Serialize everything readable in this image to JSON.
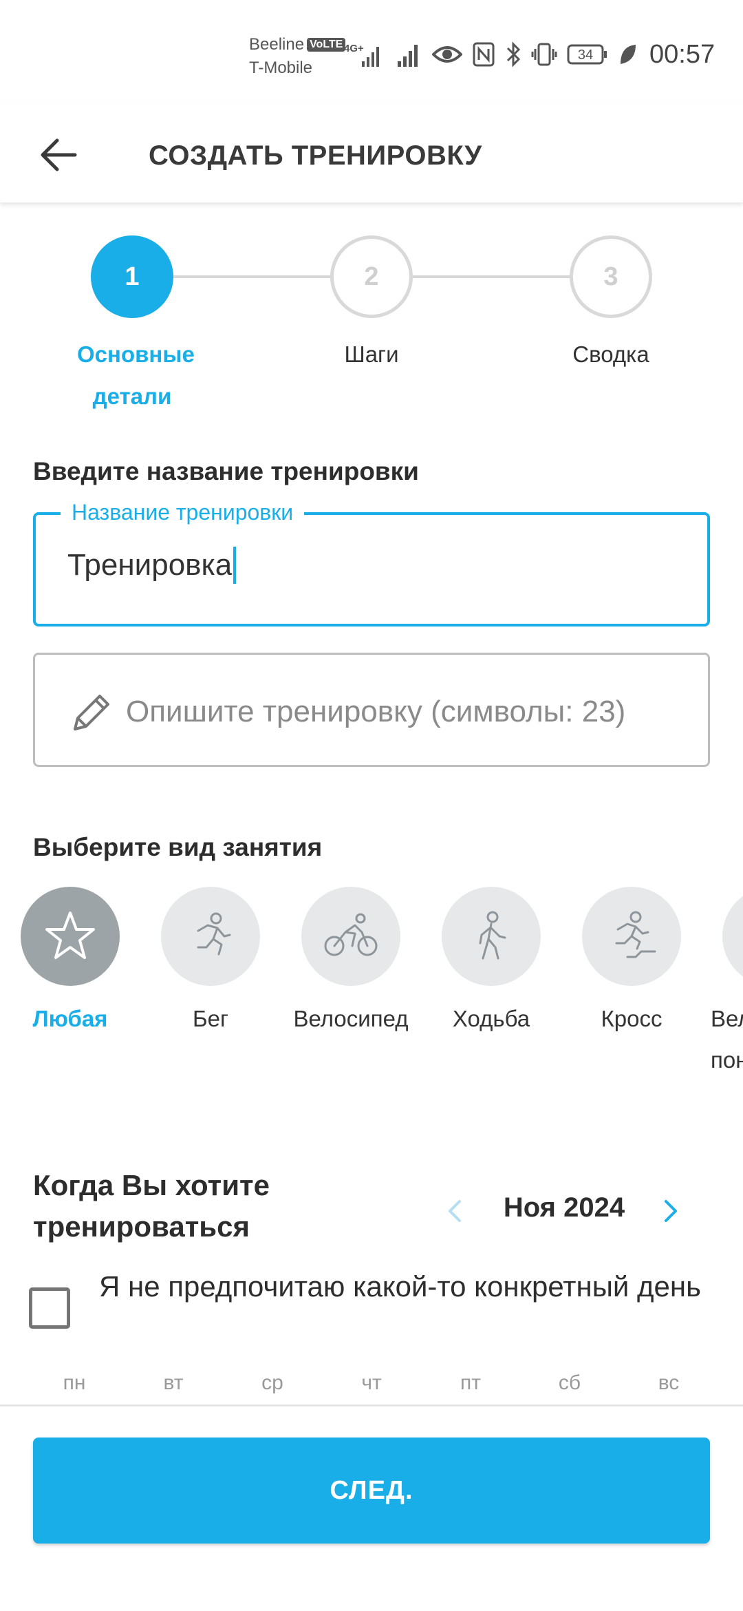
{
  "status_bar": {
    "carrier_1": "Beeline",
    "volte": "VoLTE",
    "carrier_2": "T-Mobile",
    "network": "4G+",
    "battery": "34",
    "time": "00:57"
  },
  "app_bar": {
    "back_icon": "arrow-left-icon",
    "title": "СОЗДАТЬ ТРЕНИРОВКУ"
  },
  "stepper": [
    {
      "number": "1",
      "label": "Основные детали",
      "active": true
    },
    {
      "number": "2",
      "label": "Шаги",
      "active": false
    },
    {
      "number": "3",
      "label": "Сводка",
      "active": false
    }
  ],
  "name_section": {
    "heading": "Введите название тренировки",
    "legend": "Название тренировки",
    "value": "Тренировка"
  },
  "description": {
    "placeholder": "Опишите тренировку (символы: 23)",
    "icon": "pencil-icon"
  },
  "activity_section": {
    "heading": "Выберите вид занятия",
    "items": [
      {
        "label": "Любая",
        "icon": "star-icon",
        "selected": true
      },
      {
        "label": "Бег",
        "icon": "running-icon",
        "selected": false
      },
      {
        "label": "Велосипед",
        "icon": "cycling-icon",
        "selected": false
      },
      {
        "label": "Ходьба",
        "icon": "walking-icon",
        "selected": false
      },
      {
        "label": "Кросс",
        "icon": "trail-running-icon",
        "selected": false
      },
      {
        "label": "Вел",
        "label_2": "пон",
        "icon": "cycling-icon",
        "selected": false
      }
    ]
  },
  "schedule": {
    "heading": "Когда Вы хотите тренироваться",
    "month": "Ноя 2024",
    "checkbox_label": "Я не предпочитаю какой-то конкретный день",
    "checked": false,
    "weekdays": [
      "пн",
      "вт",
      "ср",
      "чт",
      "пт",
      "сб",
      "вс"
    ]
  },
  "footer": {
    "next_label": "СЛЕД."
  },
  "colors": {
    "accent": "#1aaee8",
    "selected_activity": "#9da4a8",
    "activity_bg": "#e6e8ea"
  }
}
